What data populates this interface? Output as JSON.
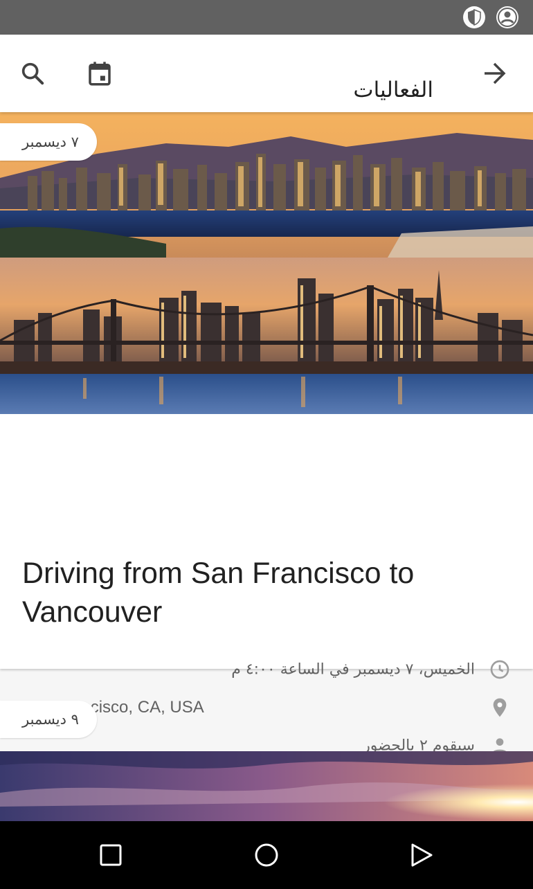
{
  "status_bar": {
    "icons": [
      "shield-icon",
      "account-icon"
    ]
  },
  "app_bar": {
    "title": "الفعاليات",
    "icons": [
      "search-icon",
      "calendar-icon",
      "back-arrow-icon"
    ]
  },
  "events": [
    {
      "date_chip": "٧ ديسمبر",
      "title": "Driving from San Francisco to Vancouver",
      "time": "الخميس، ٧ ديسمبر في الساعة ٤:٠٠ م",
      "location": "San Francisco, CA, USA",
      "attendance": "سيقوم ٢ بالحضور",
      "image_description_icons": [
        "clock-icon",
        "location-pin-icon",
        "person-icon"
      ]
    },
    {
      "date_chip": "٩ ديسمبر"
    }
  ],
  "nav_bar": {
    "icons": [
      "recents-icon",
      "home-icon",
      "back-icon"
    ]
  },
  "colors": {
    "status_bar": "#616161",
    "app_bar": "#ffffff",
    "text_primary": "#212121",
    "text_secondary": "#616161",
    "icon_gray": "#9e9e9e",
    "nav_bar": "#000000"
  }
}
